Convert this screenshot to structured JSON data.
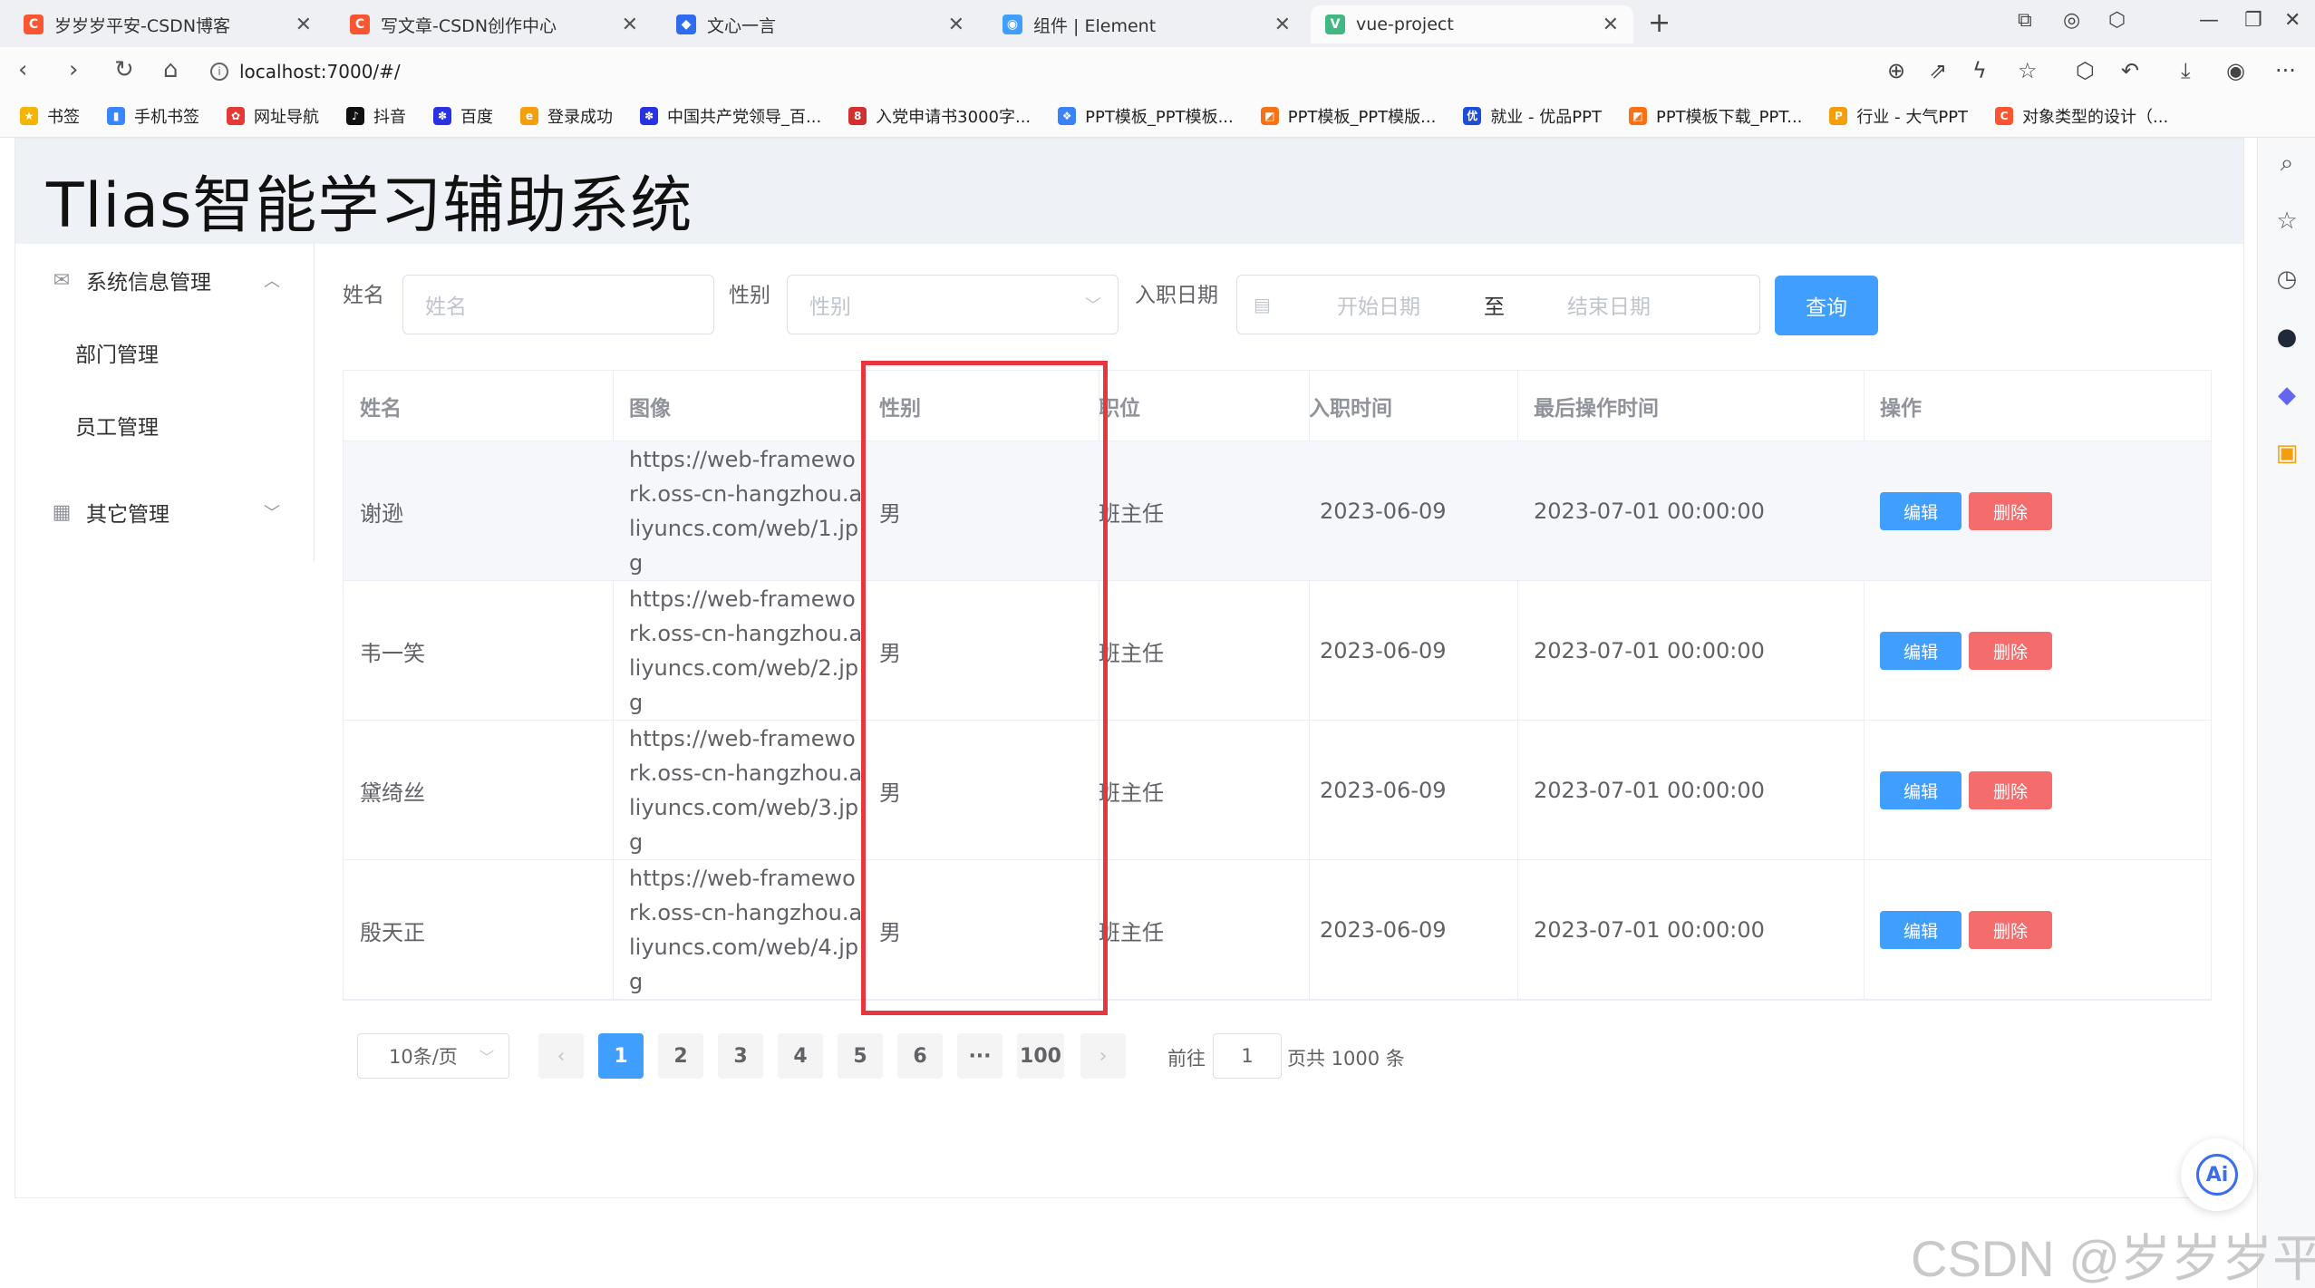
{
  "browser": {
    "tabs": [
      {
        "title": "岁岁岁平安-CSDN博客",
        "favicon": "C",
        "color": "#fc5531"
      },
      {
        "title": "写文章-CSDN创作中心",
        "favicon": "C",
        "color": "#fc5531"
      },
      {
        "title": "文心一言",
        "favicon": "◆",
        "color": "#2e6bf1"
      },
      {
        "title": "组件 | Element",
        "favicon": "◉",
        "color": "#409eff"
      },
      {
        "title": "vue-project",
        "favicon": "V",
        "color": "#41b883"
      }
    ],
    "url": "localhost:7000/#/",
    "bookmarks": [
      {
        "label": "书签",
        "color": "#f5b400",
        "glyph": "★"
      },
      {
        "label": "手机书签",
        "color": "#3a86ff",
        "glyph": "▮"
      },
      {
        "label": "网址导航",
        "color": "#e53935",
        "glyph": "✿"
      },
      {
        "label": "抖音",
        "color": "#111111",
        "glyph": "♪"
      },
      {
        "label": "百度",
        "color": "#2932e1",
        "glyph": "✽"
      },
      {
        "label": "登录成功",
        "color": "#f59e0b",
        "glyph": "e"
      },
      {
        "label": "中国共产党领导_百...",
        "color": "#2932e1",
        "glyph": "✽"
      },
      {
        "label": "入党申请书3000字...",
        "color": "#d32f2f",
        "glyph": "8"
      },
      {
        "label": "PPT模板_PPT模板...",
        "color": "#3b82f6",
        "glyph": "❖"
      },
      {
        "label": "PPT模板_PPT模版...",
        "color": "#f97316",
        "glyph": "◩"
      },
      {
        "label": "就业 - 优品PPT",
        "color": "#1d4ed8",
        "glyph": "优"
      },
      {
        "label": "PPT模板下载_PPT...",
        "color": "#f97316",
        "glyph": "◩"
      },
      {
        "label": "行业 - 大气PPT",
        "color": "#f59e0b",
        "glyph": "P"
      },
      {
        "label": "对象类型的设计（...",
        "color": "#fc5531",
        "glyph": "C"
      }
    ]
  },
  "app": {
    "title": "Tlias智能学习辅助系统",
    "menu": {
      "group1": "系统信息管理",
      "sub": [
        "部门管理",
        "员工管理"
      ],
      "group2": "其它管理"
    },
    "search": {
      "name_label": "姓名",
      "name_placeholder": "姓名",
      "gender_label": "性别",
      "gender_placeholder": "性别",
      "date_label": "入职日期",
      "start_placeholder": "开始日期",
      "range_sep": "至",
      "end_placeholder": "结束日期",
      "query_button": "查询"
    },
    "table": {
      "headers": [
        "姓名",
        "图像",
        "性别",
        "职位",
        "入职时间",
        "最后操作时间",
        "操作"
      ],
      "rows": [
        {
          "name": "谢逊",
          "image": "https://web-framework.oss-cn-hangzhou.aliyuncs.com/web/1.jpg",
          "gender": "男",
          "job": "班主任",
          "entry": "2023-06-09",
          "updated": "2023-07-01 00:00:00"
        },
        {
          "name": "韦一笑",
          "image": "https://web-framework.oss-cn-hangzhou.aliyuncs.com/web/2.jpg",
          "gender": "男",
          "job": "班主任",
          "entry": "2023-06-09",
          "updated": "2023-07-01 00:00:00"
        },
        {
          "name": "黛绮丝",
          "image": "https://web-framework.oss-cn-hangzhou.aliyuncs.com/web/3.jpg",
          "gender": "男",
          "job": "班主任",
          "entry": "2023-06-09",
          "updated": "2023-07-01 00:00:00"
        },
        {
          "name": "殷天正",
          "image": "https://web-framework.oss-cn-hangzhou.aliyuncs.com/web/4.jpg",
          "gender": "男",
          "job": "班主任",
          "entry": "2023-06-09",
          "updated": "2023-07-01 00:00:00"
        }
      ],
      "edit_label": "编辑",
      "delete_label": "删除"
    },
    "pagination": {
      "page_size": "10条/页",
      "pages": [
        "1",
        "2",
        "3",
        "4",
        "5",
        "6",
        "···",
        "100"
      ],
      "current": "1",
      "goto_label": "前往",
      "goto_value": "1",
      "total_label": "页共 1000 条"
    }
  },
  "watermark": "CSDN @岁岁岁平安",
  "ai_button": "Ai"
}
